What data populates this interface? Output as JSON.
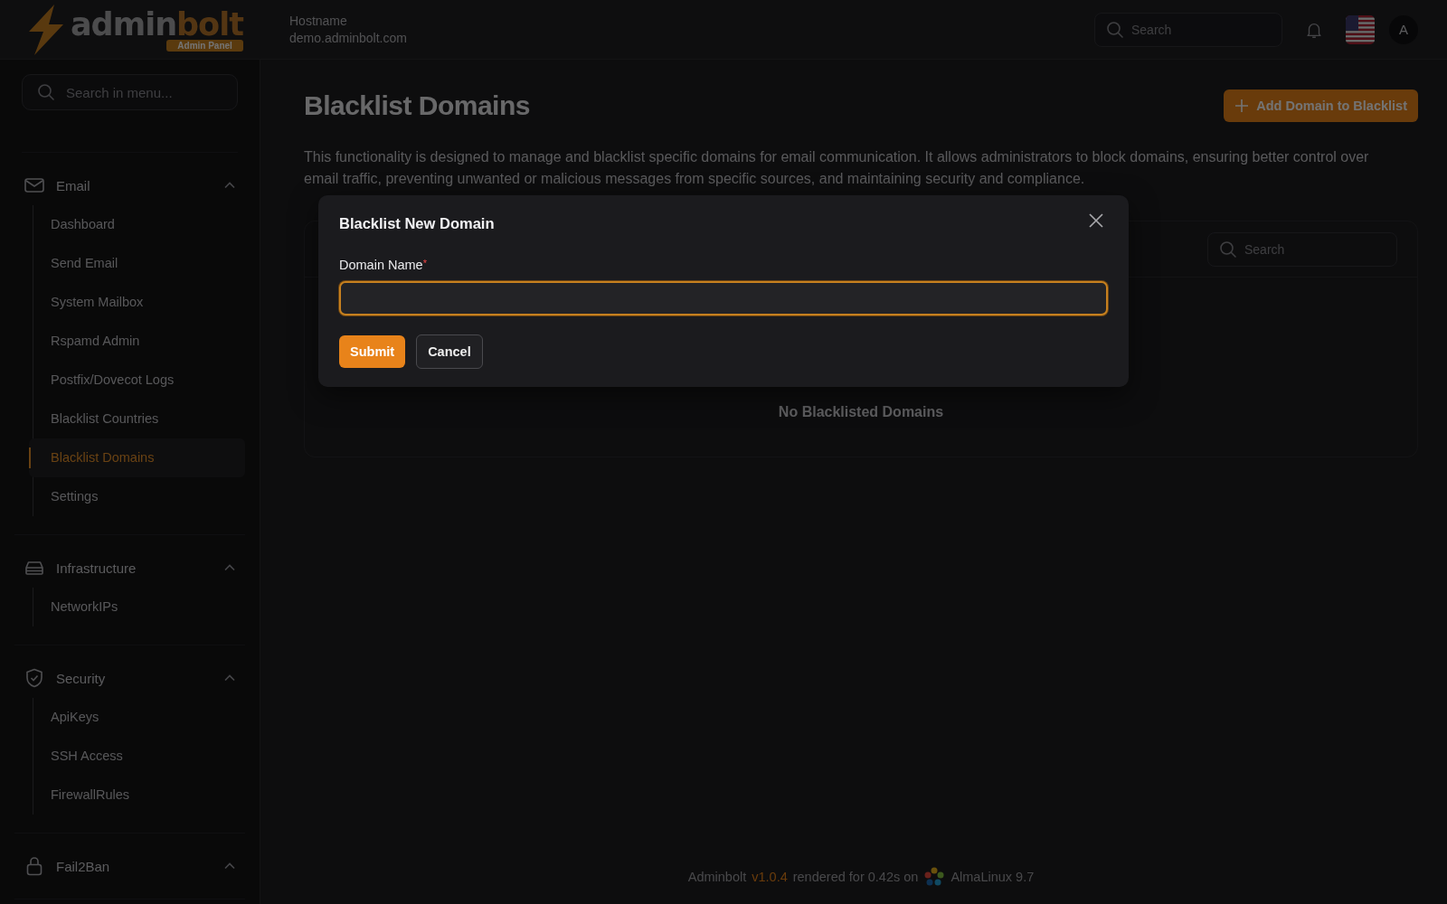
{
  "header": {
    "logo": {
      "part_a": "admin",
      "part_b": "bolt",
      "badge": "Admin Panel"
    },
    "hostname_label": "Hostname",
    "hostname": "demo.adminbolt.com",
    "search": {
      "placeholder": "Search"
    },
    "avatar": "A"
  },
  "sidebar": {
    "search": {
      "placeholder": "Search in menu..."
    },
    "groups": [
      {
        "label": "Email",
        "expanded": true,
        "items": [
          {
            "label": "Dashboard",
            "selected": false
          },
          {
            "label": "Send Email",
            "selected": false
          },
          {
            "label": "System Mailbox",
            "selected": false
          },
          {
            "label": "Rspamd Admin",
            "selected": false
          },
          {
            "label": "Postfix/Dovecot Logs",
            "selected": false
          },
          {
            "label": "Blacklist Countries",
            "selected": false
          },
          {
            "label": "Blacklist Domains",
            "selected": true
          },
          {
            "label": "Settings",
            "selected": false
          }
        ]
      },
      {
        "label": "Infrastructure",
        "expanded": true,
        "items": [
          {
            "label": "NetworkIPs",
            "selected": false
          }
        ]
      },
      {
        "label": "Security",
        "expanded": true,
        "items": [
          {
            "label": "ApiKeys",
            "selected": false
          },
          {
            "label": "SSH Access",
            "selected": false
          },
          {
            "label": "FirewallRules",
            "selected": false
          }
        ]
      },
      {
        "label": "Fail2Ban",
        "expanded": true
      }
    ]
  },
  "page": {
    "title": "Blacklist Domains",
    "add_button": "Add Domain to Blacklist",
    "description": "This functionality is designed to manage and blacklist specific domains for email communication. It allows administrators to block domains, ensuring better control over email traffic, preventing unwanted or malicious messages from specific sources, and maintaining security and compliance.",
    "table": {
      "search": {
        "placeholder": "Search"
      },
      "empty_text": "No Blacklisted Domains"
    }
  },
  "footer": {
    "app": "Adminbolt",
    "version": "v1.0.4",
    "rendered": "rendered for 0.42s on",
    "os": "AlmaLinux 9.7"
  },
  "modal": {
    "title": "Blacklist New Domain",
    "field": {
      "label": "Domain Name",
      "required_mark": "*",
      "focused": true
    },
    "buttons": [
      {
        "label": "Submit",
        "kind": "primary"
      },
      {
        "label": "Cancel",
        "kind": "secondary"
      }
    ]
  }
}
